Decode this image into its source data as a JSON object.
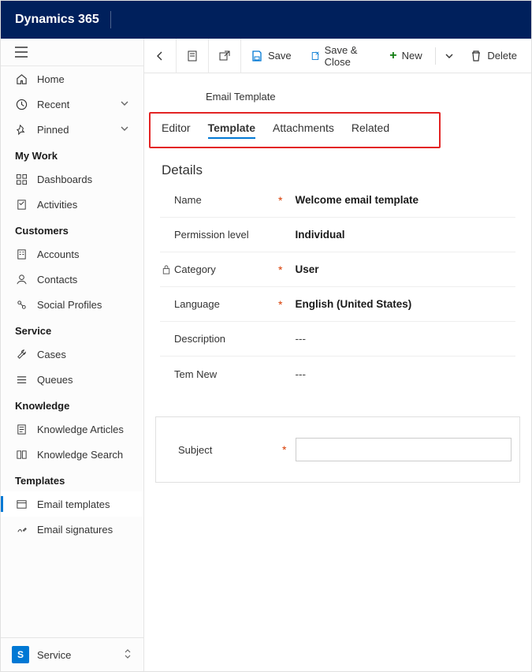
{
  "app_title": "Dynamics 365",
  "cmdbar": {
    "save": "Save",
    "save_close": "Save & Close",
    "new": "New",
    "delete": "Delete"
  },
  "sidebar": {
    "home": "Home",
    "recent": "Recent",
    "pinned": "Pinned",
    "groups": {
      "my_work": "My Work",
      "customers": "Customers",
      "service": "Service",
      "knowledge": "Knowledge",
      "templates": "Templates"
    },
    "items": {
      "dashboards": "Dashboards",
      "activities": "Activities",
      "accounts": "Accounts",
      "contacts": "Contacts",
      "social_profiles": "Social Profiles",
      "cases": "Cases",
      "queues": "Queues",
      "knowledge_articles": "Knowledge Articles",
      "knowledge_search": "Knowledge Search",
      "email_templates": "Email templates",
      "email_signatures": "Email signatures"
    },
    "footer": {
      "badge": "S",
      "label": "Service"
    }
  },
  "page": {
    "breadcrumb": "Email Template",
    "tabs": {
      "editor": "Editor",
      "template": "Template",
      "attachments": "Attachments",
      "related": "Related"
    },
    "section_title": "Details",
    "fields": {
      "name_label": "Name",
      "name_value": "Welcome email template",
      "permission_label": "Permission level",
      "permission_value": "Individual",
      "category_label": "Category",
      "category_value": "User",
      "language_label": "Language",
      "language_value": "English (United States)",
      "description_label": "Description",
      "description_value": "---",
      "temnew_label": "Tem New",
      "temnew_value": "---",
      "subject_label": "Subject"
    }
  }
}
